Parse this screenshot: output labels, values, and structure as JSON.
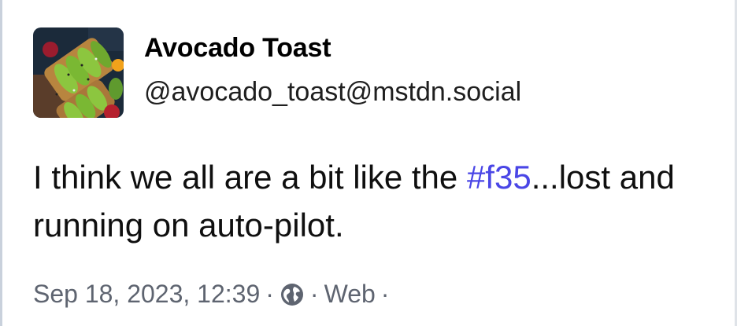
{
  "account": {
    "display_name": "Avocado Toast",
    "handle": "@avocado_toast@mstdn.social",
    "avatar_icon": "avocado-toast-photo"
  },
  "status": {
    "text_before": "I think we all are a bit like the ",
    "hashtag": "#f35",
    "text_after": "...lost and running on auto-pilot."
  },
  "meta": {
    "timestamp": "Sep 18, 2023, 12:39",
    "separator": "·",
    "visibility_icon": "globe-icon",
    "application": "Web"
  },
  "colors": {
    "hashtag": "#4a46e6",
    "meta_text": "#5e6470"
  }
}
